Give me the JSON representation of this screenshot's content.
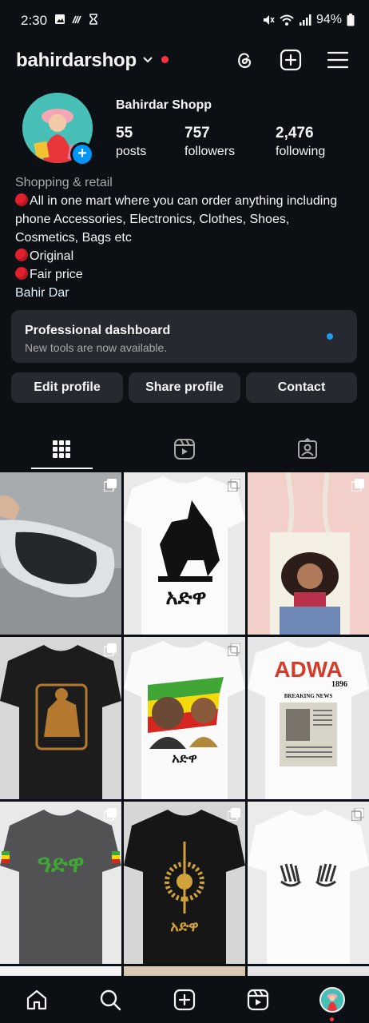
{
  "status": {
    "time": "2:30",
    "battery": "94%",
    "left_icons": [
      "image-icon",
      "wifi-calling-icon",
      "hourglass-icon"
    ],
    "right_icons": [
      "mute-icon",
      "wifi-icon",
      "signal-icon",
      "battery-icon"
    ]
  },
  "header": {
    "username": "bahirdarshop",
    "actions": [
      "threads-icon",
      "create-icon",
      "menu-icon"
    ]
  },
  "profile": {
    "display_name": "Bahirdar Shopp",
    "stats": [
      {
        "value": "55",
        "label": "posts"
      },
      {
        "value": "757",
        "label": "followers"
      },
      {
        "value": "2,476",
        "label": "following"
      }
    ],
    "category": "Shopping & retail",
    "bio_line1": "All in one mart where you can order anything including",
    "bio_line2": "phone Accessories, Electronics, Clothes, Shoes,",
    "bio_line3": "Cosmetics, Bags etc",
    "bio_line4": "Original",
    "bio_line5": "Fair price",
    "location": "Bahir Dar"
  },
  "dashboard": {
    "title": "Professional dashboard",
    "subtitle": "New tools are now available."
  },
  "buttons": {
    "edit": "Edit profile",
    "share": "Share profile",
    "contact": "Contact"
  },
  "tabs": [
    "grid-icon",
    "reels-icon",
    "tagged-icon"
  ],
  "grid": {
    "posts": [
      {
        "subject": "sunglasses"
      },
      {
        "subject": "white t-shirt horseman",
        "text": "አድዋ"
      },
      {
        "subject": "tote bag portrait"
      },
      {
        "subject": "black t-shirt emblem"
      },
      {
        "subject": "white t-shirt portraits",
        "text": "አድዋ"
      },
      {
        "subject": "white t-shirt newspaper",
        "text": "ADWA",
        "year": "1896",
        "caption": "BREAKING NEWS"
      },
      {
        "subject": "grey t-shirt",
        "text": "ዓድዋ"
      },
      {
        "subject": "black t-shirt shield",
        "text": "አድዋ"
      },
      {
        "subject": "white t-shirt hands"
      }
    ]
  },
  "colors": {
    "background": "#0c1014",
    "surface": "#262a30",
    "accent": "#0095f6",
    "notification": "#ff3040"
  },
  "bottom_nav": [
    "home-icon",
    "search-icon",
    "create-icon",
    "reels-icon",
    "profile-avatar"
  ]
}
